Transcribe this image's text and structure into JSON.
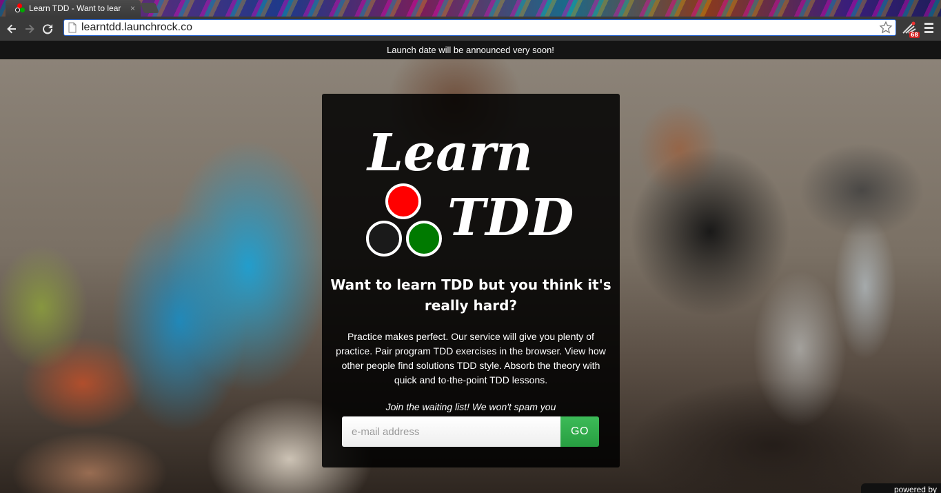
{
  "browser": {
    "tab_title": "Learn TDD - Want to lear",
    "tab_close": "×",
    "url": "learntdd.launchrock.co",
    "extension_badge": "68"
  },
  "page": {
    "announcement": "Launch date will be announced very soon!",
    "logo": {
      "word1": "Learn",
      "word2": "TDD",
      "dot_colors": [
        "#ff0000",
        "#1a1a1a",
        "#007a00"
      ]
    },
    "headline": "Want to learn TDD but you think it's really hard?",
    "description": "Practice makes perfect. Our service will give you plenty of practice. Pair program TDD exercises in the browser. View how other people find solutions TDD style. Absorb the theory with quick and to-the-point TDD lessons.",
    "waiting_text": "Join the waiting list! We won't spam you",
    "email_placeholder": "e-mail address",
    "go_label": "GO",
    "powered_by": "powered by"
  }
}
